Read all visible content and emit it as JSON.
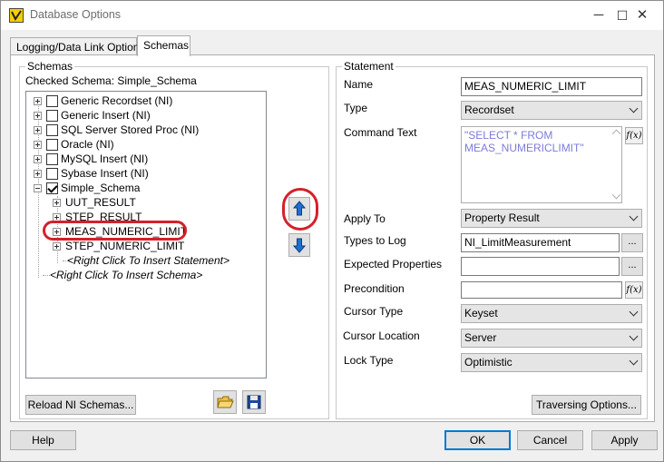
{
  "window": {
    "title": "Database Options",
    "minimize": "─",
    "maximize": "☐",
    "close": "✕"
  },
  "tabs": [
    {
      "label": "Logging/Data Link Options",
      "active": false
    },
    {
      "label": "Schemas",
      "active": true
    }
  ],
  "schemas": {
    "group_title": "Schemas",
    "checked_schema": "Checked Schema: Simple_Schema",
    "tree": [
      {
        "label": "Generic Recordset (NI)",
        "checked": false
      },
      {
        "label": "Generic Insert (NI)",
        "checked": false
      },
      {
        "label": "SQL Server Stored Proc (NI)",
        "checked": false
      },
      {
        "label": "Oracle (NI)",
        "checked": false
      },
      {
        "label": "MySQL Insert (NI)",
        "checked": false
      },
      {
        "label": "Sybase Insert (NI)",
        "checked": false
      },
      {
        "label": "Simple_Schema",
        "checked": true
      }
    ],
    "statements": [
      "UUT_RESULT",
      "STEP_RESULT",
      "MEAS_NUMERIC_LIMIT",
      "STEP_NUMERIC_LIMIT"
    ],
    "insert_statement_hint": "<Right Click To Insert Statement>",
    "insert_schema_hint": "<Right Click To Insert Schema>",
    "reload_button": "Reload NI Schemas..."
  },
  "icons": {
    "move_up": "arrow-up-icon",
    "move_down": "arrow-down-icon",
    "open": "folder-open-icon",
    "save": "floppy-disk-icon",
    "app": "teststand-icon"
  },
  "statement": {
    "group_title": "Statement",
    "name_label": "Name",
    "name_value": "MEAS_NUMERIC_LIMIT",
    "type_label": "Type",
    "type_value": "Recordset",
    "command_label": "Command Text",
    "command_line1": "\"SELECT * FROM",
    "command_line2": "MEAS_NUMERICLIMIT\"",
    "fx_label": "f(x)",
    "apply_to_label": "Apply To",
    "apply_to_value": "Property Result",
    "types_label": "Types to Log",
    "types_value": "NI_LimitMeasurement",
    "expected_label": "Expected Properties",
    "expected_value": "",
    "precondition_label": "Precondition",
    "precondition_value": "",
    "cursor_type_label": "Cursor Type",
    "cursor_type_value": "Keyset",
    "cursor_loc_label": "Cursor Location",
    "cursor_loc_value": "Server",
    "lock_label": "Lock Type",
    "lock_value": "Optimistic",
    "ellipsis": "...",
    "traversing_button": "Traversing Options..."
  },
  "footer": {
    "help": "Help",
    "ok": "OK",
    "cancel": "Cancel",
    "apply": "Apply"
  },
  "colors": {
    "highlight": "#d3212c",
    "accent": "#0078d7",
    "arrow": "#1e6fd0",
    "command_text": "#7d7bd9"
  }
}
